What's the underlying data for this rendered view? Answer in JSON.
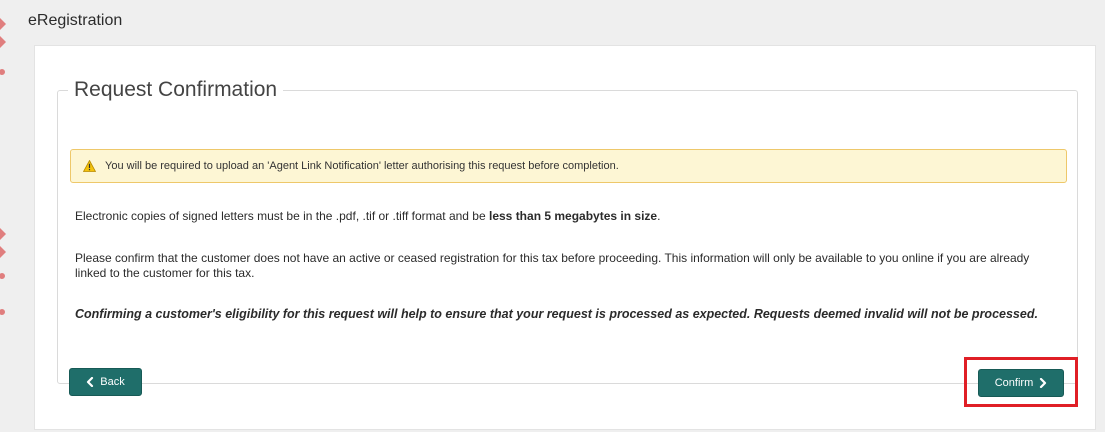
{
  "app": {
    "title": "eRegistration"
  },
  "section": {
    "legend": "Request Confirmation"
  },
  "warning": {
    "icon": "warning-triangle-icon",
    "text": "You will be required to upload an 'Agent Link Notification' letter authorising this request before completion."
  },
  "body": {
    "format_text": "Electronic copies of signed letters must be in the .pdf, .tif or .tiff format and be ",
    "format_bold": "less than 5 megabytes in size",
    "format_end": ".",
    "confirm_text": "Please confirm that the customer does not have an active or ceased registration for this tax before proceeding. This information will only be available to you online if you are already linked to the customer for this tax.",
    "eligibility_text": "Confirming a customer's eligibility for this request will help to ensure that your request is processed as expected. Requests deemed invalid will not be processed."
  },
  "buttons": {
    "back_label": "Back",
    "confirm_label": "Confirm"
  },
  "colors": {
    "button": "#1f6e6a",
    "warning_bg": "#fdf6d4",
    "highlight": "#e01f26"
  }
}
